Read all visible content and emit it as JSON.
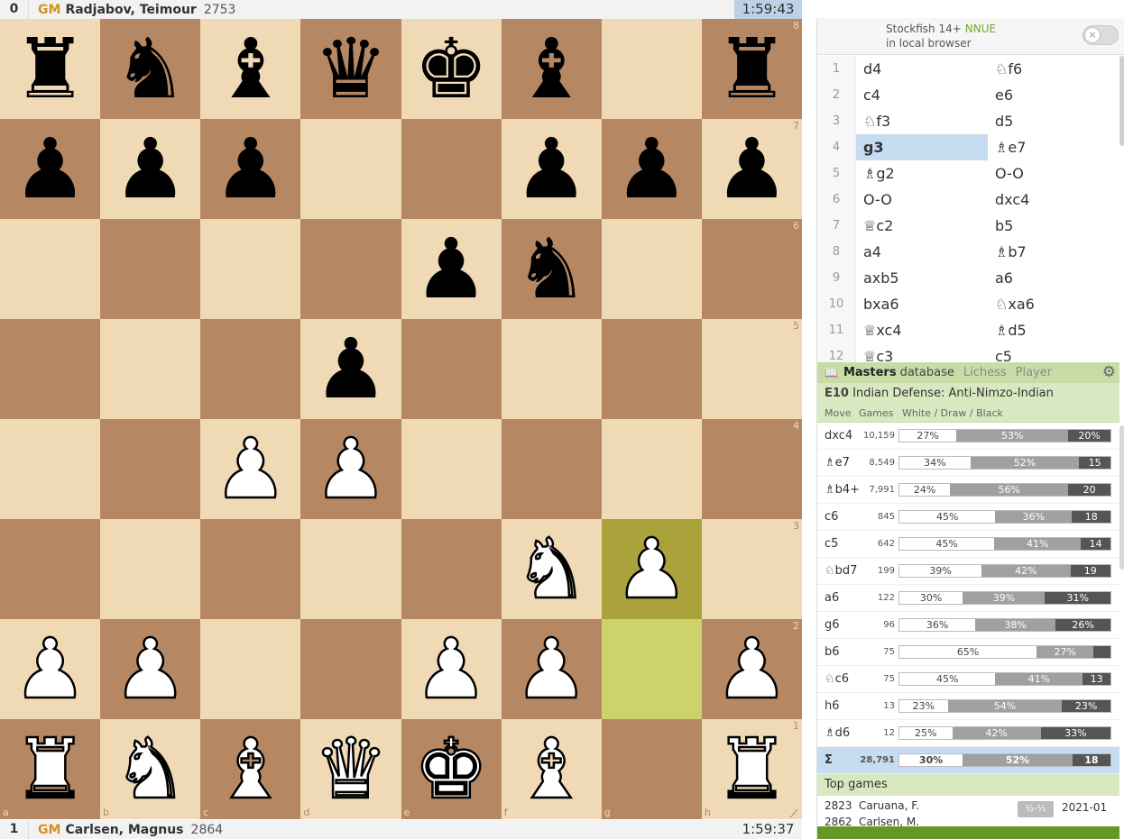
{
  "top_player": {
    "score": "0",
    "title": "GM",
    "name": "Radjabov, Teimour",
    "rating": "2753",
    "clock": "1:59:43"
  },
  "bottom_player": {
    "score": "1",
    "title": "GM",
    "name": "Carlsen, Magnus",
    "rating": "2864",
    "clock": "1:59:37"
  },
  "board": {
    "rows": [
      [
        "r",
        "n",
        "b",
        "q",
        "k",
        "b",
        "",
        "r"
      ],
      [
        "p",
        "p",
        "p",
        "",
        "",
        "p",
        "p",
        "p"
      ],
      [
        "",
        "",
        "",
        "",
        "p",
        "n",
        "",
        ""
      ],
      [
        "",
        "",
        "",
        "p",
        "",
        "",
        "",
        ""
      ],
      [
        "",
        "",
        "P",
        "P",
        "",
        "",
        "",
        ""
      ],
      [
        "",
        "",
        "",
        "",
        "",
        "N",
        "P",
        ""
      ],
      [
        "P",
        "P",
        "",
        "",
        "P",
        "P",
        "",
        "P"
      ],
      [
        "R",
        "N",
        "B",
        "Q",
        "K",
        "B",
        "",
        "R"
      ]
    ],
    "highlight": [
      [
        5,
        6
      ],
      [
        6,
        6
      ]
    ],
    "ranks": [
      "8",
      "7",
      "6",
      "5",
      "4",
      "3",
      "2",
      "1"
    ],
    "files": [
      "a",
      "b",
      "c",
      "d",
      "e",
      "f",
      "g",
      "h"
    ]
  },
  "engine": {
    "name": "Stockfish 14+",
    "nnue": "NNUE",
    "sub": "in local browser",
    "toggle_icon": "×"
  },
  "moves": [
    {
      "n": "1",
      "w": "d4",
      "b": "♘f6"
    },
    {
      "n": "2",
      "w": "c4",
      "b": "e6"
    },
    {
      "n": "3",
      "w": "♘f3",
      "b": "d5"
    },
    {
      "n": "4",
      "w": "g3",
      "b": "♗e7",
      "active": "w"
    },
    {
      "n": "5",
      "w": "♗g2",
      "b": "O-O"
    },
    {
      "n": "6",
      "w": "O-O",
      "b": "dxc4"
    },
    {
      "n": "7",
      "w": "♕c2",
      "b": "b5"
    },
    {
      "n": "8",
      "w": "a4",
      "b": "♗b7"
    },
    {
      "n": "9",
      "w": "axb5",
      "b": "a6"
    },
    {
      "n": "10",
      "w": "bxa6",
      "b": "♘xa6"
    },
    {
      "n": "11",
      "w": "♕xc4",
      "b": "♗d5"
    },
    {
      "n": "12",
      "w": "♕c3",
      "b": "c5"
    }
  ],
  "explorer": {
    "book_icon": "📖",
    "tab_masters": "Masters",
    "tab_masters_suffix": "database",
    "tab_lichess": "Lichess",
    "tab_player": "Player",
    "gear_icon": "⚙",
    "eco": "E10",
    "opening": "Indian Defense: Anti-Nimzo-Indian",
    "col_move": "Move",
    "col_games": "Games",
    "col_wdb": "White / Draw / Black",
    "rows": [
      {
        "move": "dxc4",
        "games": "10,159",
        "w": 27,
        "d": 53,
        "b": 20,
        "wl": "27%",
        "dl": "53%",
        "bl": "20%"
      },
      {
        "move": "♗e7",
        "games": "8,549",
        "w": 34,
        "d": 52,
        "b": 15,
        "wl": "34%",
        "dl": "52%",
        "bl": "15"
      },
      {
        "move": "♗b4+",
        "games": "7,991",
        "w": 24,
        "d": 56,
        "b": 20,
        "wl": "24%",
        "dl": "56%",
        "bl": "20"
      },
      {
        "move": "c6",
        "games": "845",
        "w": 45,
        "d": 36,
        "b": 18,
        "wl": "45%",
        "dl": "36%",
        "bl": "18"
      },
      {
        "move": "c5",
        "games": "642",
        "w": 45,
        "d": 41,
        "b": 14,
        "wl": "45%",
        "dl": "41%",
        "bl": "14"
      },
      {
        "move": "♘bd7",
        "games": "199",
        "w": 39,
        "d": 42,
        "b": 19,
        "wl": "39%",
        "dl": "42%",
        "bl": "19"
      },
      {
        "move": "a6",
        "games": "122",
        "w": 30,
        "d": 39,
        "b": 31,
        "wl": "30%",
        "dl": "39%",
        "bl": "31%"
      },
      {
        "move": "g6",
        "games": "96",
        "w": 36,
        "d": 38,
        "b": 26,
        "wl": "36%",
        "dl": "38%",
        "bl": "26%"
      },
      {
        "move": "b6",
        "games": "75",
        "w": 65,
        "d": 27,
        "b": 8,
        "wl": "65%",
        "dl": "27%",
        "bl": ""
      },
      {
        "move": "♘c6",
        "games": "75",
        "w": 45,
        "d": 41,
        "b": 13,
        "wl": "45%",
        "dl": "41%",
        "bl": "13"
      },
      {
        "move": "h6",
        "games": "13",
        "w": 23,
        "d": 54,
        "b": 23,
        "wl": "23%",
        "dl": "54%",
        "bl": "23%"
      },
      {
        "move": "♗d6",
        "games": "12",
        "w": 25,
        "d": 42,
        "b": 33,
        "wl": "25%",
        "dl": "42%",
        "bl": "33%"
      }
    ],
    "sum": {
      "move": "Σ",
      "games": "28,791",
      "w": 30,
      "d": 52,
      "b": 18,
      "wl": "30%",
      "dl": "52%",
      "bl": "18"
    },
    "top_games_label": "Top games",
    "top_games": [
      {
        "rating": "2823",
        "name": "Caruana, F."
      },
      {
        "rating": "2862",
        "name": "Carlsen, M."
      }
    ],
    "top_game_result": "½-½",
    "top_game_date": "2021-01"
  }
}
